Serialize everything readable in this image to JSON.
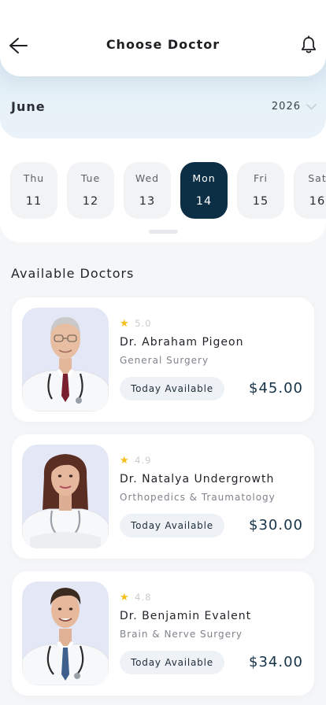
{
  "header": {
    "title": "Choose Doctor",
    "back_icon": "arrow-left-icon",
    "notification_icon": "bell-icon"
  },
  "calendar": {
    "month": "June",
    "year": "2026",
    "days": [
      {
        "name": "Thu",
        "date": "11",
        "active": false
      },
      {
        "name": "Tue",
        "date": "12",
        "active": false
      },
      {
        "name": "Wed",
        "date": "13",
        "active": false
      },
      {
        "name": "Mon",
        "date": "14",
        "active": true
      },
      {
        "name": "Fri",
        "date": "15",
        "active": false
      },
      {
        "name": "Sat",
        "date": "16",
        "active": false
      }
    ]
  },
  "section": {
    "title": "Available Doctors"
  },
  "doctors": [
    {
      "rating": "5.0",
      "name": "Dr. Abraham Pigeon",
      "specialty": "General Surgery",
      "availability": "Today Available",
      "price": "$45.00"
    },
    {
      "rating": "4.9",
      "name": "Dr. Natalya Undergrowth",
      "specialty": "Orthopedics & Traumatology",
      "availability": "Today Available",
      "price": "$30.00"
    },
    {
      "rating": "4.8",
      "name": "Dr. Benjamin Evalent",
      "specialty": "Brain & Nerve Surgery",
      "availability": "Today Available",
      "price": "$34.00"
    }
  ],
  "colors": {
    "accent": "#0c2f45",
    "star": "#f5bd19",
    "badge_bg": "#eef2f6",
    "photo_bg": "#e4e7f6"
  }
}
